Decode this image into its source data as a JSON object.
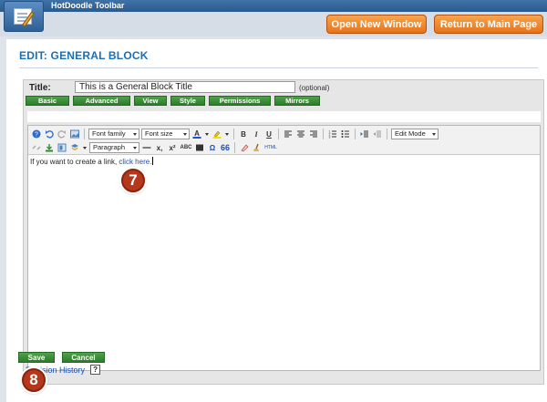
{
  "app": {
    "title": "HotDoodle Toolbar"
  },
  "header": {
    "open_new_window": "Open New Window",
    "return_main": "Return to Main Page"
  },
  "page": {
    "title": "EDIT: GENERAL BLOCK"
  },
  "form": {
    "title_label": "Title:",
    "title_value": "This is a General Block Title",
    "optional_note": "(optional)"
  },
  "tabs": [
    "Basic",
    "Advanced",
    "View",
    "Style",
    "Permissions",
    "Mirrors"
  ],
  "toolbar": {
    "font_family": "Font family",
    "font_size": "Font size",
    "edit_mode": "Edit Mode",
    "paragraph": "Paragraph",
    "bold": "B",
    "italic": "I",
    "underline": "U",
    "spellcheck": "ABC",
    "omega": "Ω",
    "quote": "66",
    "html": "HTML",
    "subscript": "x,",
    "superscript": "x²"
  },
  "editor": {
    "content_text": "If you want to create a link,",
    "link_text": "click here."
  },
  "revision": {
    "link": "Revision History",
    "help": "?"
  },
  "buttons": {
    "save": "Save",
    "cancel": "Cancel"
  },
  "steps": {
    "seven": "7",
    "eight": "8"
  }
}
